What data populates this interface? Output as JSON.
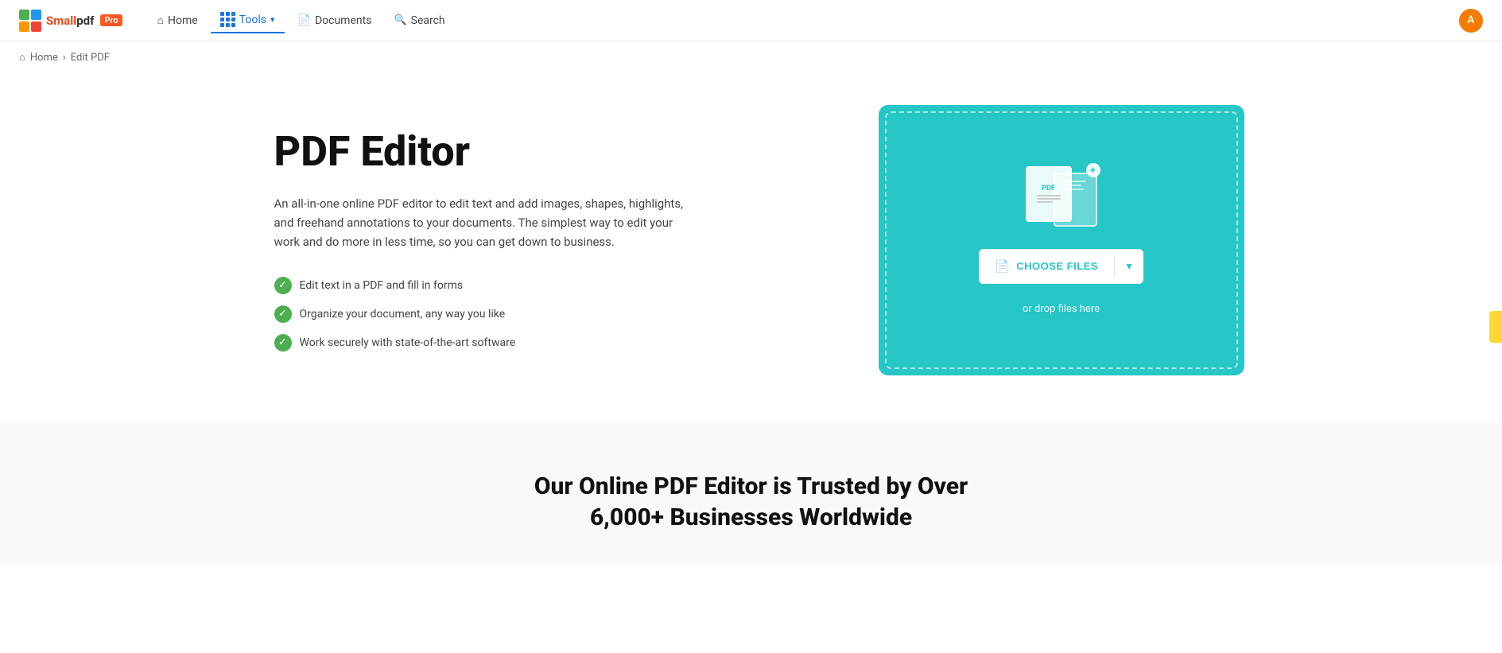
{
  "brand": {
    "small": "Small",
    "pdf": "pdf",
    "pro": "Pro"
  },
  "nav": {
    "home_label": "Home",
    "tools_label": "Tools",
    "documents_label": "Documents",
    "search_label": "Search",
    "avatar_initials": "A"
  },
  "breadcrumb": {
    "home": "Home",
    "separator": "›",
    "current": "Edit PDF"
  },
  "hero": {
    "title": "PDF Editor",
    "description": "An all-in-one online PDF editor to edit text and add images, shapes, highlights, and freehand annotations to your documents. The simplest way to edit your work and do more in less time, so you can get down to business.",
    "features": [
      "Edit text in a PDF and fill in forms",
      "Organize your document, any way you like",
      "Work securely with state-of-the-art software"
    ]
  },
  "upload": {
    "button_label": "CHOOSE FILES",
    "drop_label": "or drop files here"
  },
  "bottom": {
    "title": "Our Online PDF Editor is Trusted by Over 6,000+ Businesses Worldwide"
  },
  "icons": {
    "chevron_down": "▾",
    "doc_icon": "📄",
    "check": "✓",
    "home_unicode": "⌂",
    "search_unicode": "🔍"
  }
}
